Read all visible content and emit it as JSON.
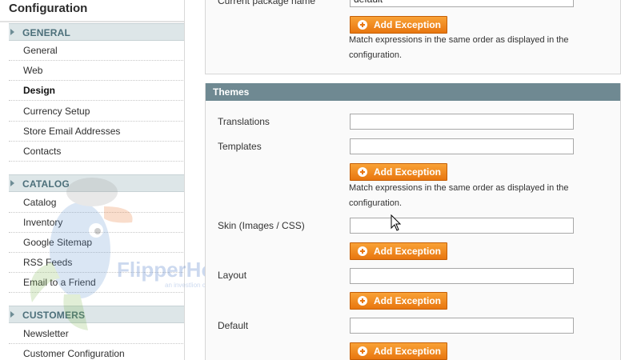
{
  "sidebar": {
    "title": "Configuration",
    "sections": {
      "general": {
        "label": "GENERAL",
        "items": [
          "General",
          "Web",
          "Design",
          "Currency Setup",
          "Store Email Addresses",
          "Contacts"
        ]
      },
      "catalog": {
        "label": "CATALOG",
        "items": [
          "Catalog",
          "Inventory",
          "Google Sitemap",
          "RSS Feeds",
          "Email to a Friend"
        ]
      },
      "customers": {
        "label": "CUSTOMERS",
        "items": [
          "Newsletter",
          "Customer Configuration"
        ]
      }
    },
    "active_item": "Design"
  },
  "watermark": {
    "brand": "FlipperHost",
    "tagline": "an investlion company",
    "icon": "fish-mascot-icon"
  },
  "top_panel": {
    "field_label_partial": "Current package name",
    "field_value": "default",
    "add_exception_label": "Add Exception",
    "note": [
      "Match expressions in the same order as displayed in the",
      "configuration."
    ]
  },
  "themes_panel": {
    "title": "Themes",
    "add_exception_label": "Add Exception",
    "note": [
      "Match expressions in the same order as displayed in the",
      "configuration."
    ],
    "fields": {
      "translations": {
        "label": "Translations",
        "value": ""
      },
      "templates": {
        "label": "Templates",
        "value": ""
      },
      "skin": {
        "label": "Skin (Images / CSS)",
        "value": ""
      },
      "layout": {
        "label": "Layout",
        "value": ""
      },
      "default": {
        "label": "Default",
        "value": ""
      }
    }
  },
  "colors": {
    "accent": "#f08a1e",
    "section_header": "#6f8992",
    "nav_header_bg": "#dde6e8",
    "nav_header_text": "#4c6f7a"
  }
}
